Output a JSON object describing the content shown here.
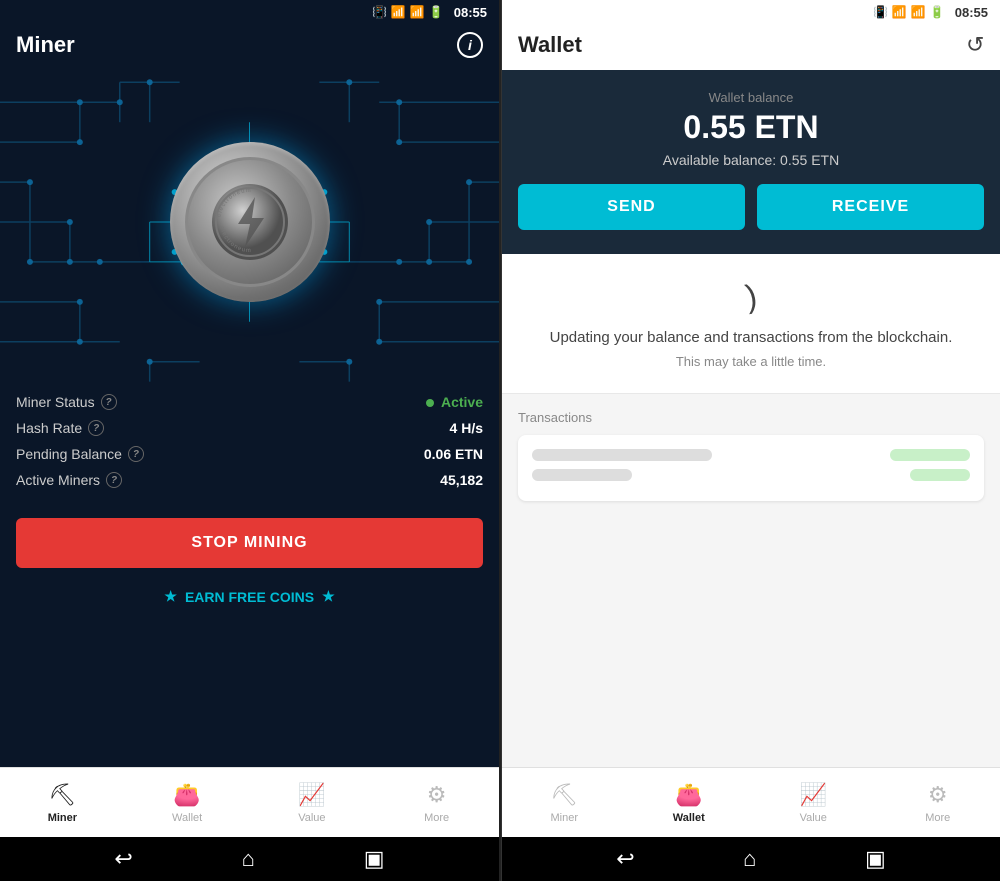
{
  "miner": {
    "status_bar": {
      "time": "08:55"
    },
    "title": "Miner",
    "info_icon": "i",
    "stats": {
      "miner_status_label": "Miner Status",
      "miner_status_value": "Active",
      "hash_rate_label": "Hash Rate",
      "hash_rate_value": "4 H/s",
      "pending_balance_label": "Pending Balance",
      "pending_balance_value": "0.06 ETN",
      "active_miners_label": "Active Miners",
      "active_miners_value": "45,182"
    },
    "stop_button": "STOP MINING",
    "earn_free": "EARN FREE COINS",
    "nav": {
      "items": [
        {
          "id": "miner",
          "label": "Miner",
          "icon": "⛏",
          "active": true
        },
        {
          "id": "wallet",
          "label": "Wallet",
          "icon": "👛",
          "active": false
        },
        {
          "id": "value",
          "label": "Value",
          "icon": "📈",
          "active": false
        },
        {
          "id": "more",
          "label": "More",
          "icon": "⚙",
          "active": false
        }
      ]
    }
  },
  "wallet": {
    "status_bar": {
      "time": "08:55"
    },
    "title": "Wallet",
    "balance_label": "Wallet balance",
    "balance_amount": "0.55 ETN",
    "available_balance": "Available balance: 0.55 ETN",
    "send_button": "SEND",
    "receive_button": "RECEIVE",
    "sync_text": "Updating your balance and transactions from the blockchain.",
    "sync_subtext": "This may take a little time.",
    "transactions_label": "Transactions",
    "nav": {
      "items": [
        {
          "id": "miner",
          "label": "Miner",
          "icon": "⛏",
          "active": false
        },
        {
          "id": "wallet",
          "label": "Wallet",
          "icon": "👛",
          "active": true
        },
        {
          "id": "value",
          "label": "Value",
          "icon": "📈",
          "active": false
        },
        {
          "id": "more",
          "label": "More",
          "icon": "⚙",
          "active": false
        }
      ]
    }
  },
  "colors": {
    "accent_cyan": "#00bcd4",
    "active_green": "#4caf50",
    "stop_red": "#e53935",
    "dark_bg": "#0a1628",
    "wallet_dark": "#1a2a3a"
  }
}
